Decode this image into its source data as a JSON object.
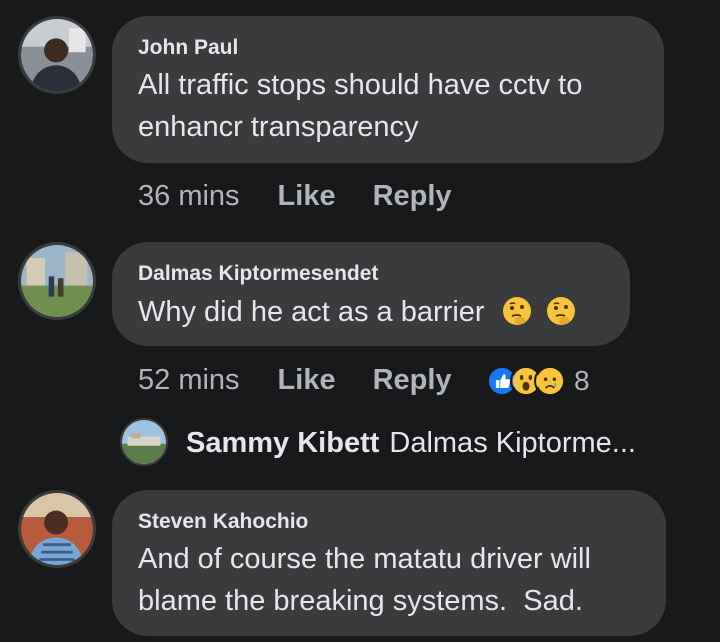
{
  "comments": [
    {
      "author": "John Paul",
      "text_lines": [
        "All traffic stops should have cctv to",
        "enhancr transparency"
      ],
      "time": "36 mins",
      "like_label": "Like",
      "reply_label": "Reply"
    },
    {
      "author": "Dalmas Kiptormesendet",
      "text": "Why did he act as a barrier",
      "time": "52 mins",
      "like_label": "Like",
      "reply_label": "Reply",
      "reactions": [
        "like-icon",
        "wow-icon",
        "sad-icon"
      ],
      "reaction_count": "8",
      "reply_preview": {
        "author": "Sammy Kibett",
        "text": "Dalmas Kiptorme..."
      }
    },
    {
      "author": "Steven Kahochio",
      "text_lines": [
        "And of course the matatu driver will",
        "blame the breaking systems.  Sad."
      ]
    }
  ],
  "colors": {
    "background": "#18191a",
    "bubble": "#3a3b3c",
    "primary_text": "#e4e6eb",
    "secondary_text": "#b0b3b8",
    "like_blue": "#1877f2"
  }
}
